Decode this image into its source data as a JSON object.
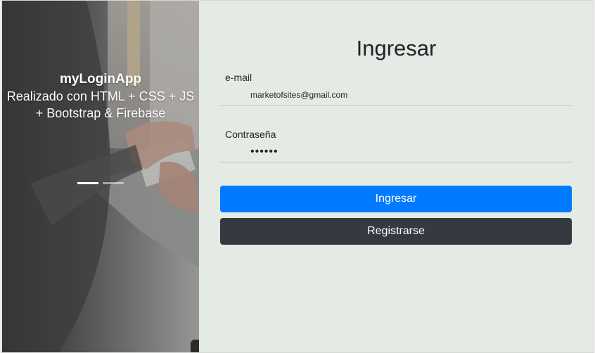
{
  "hero": {
    "title": "myLoginApp",
    "subtitle": "Realizado con HTML + CSS + JS + Bootstrap & Firebase",
    "slides": 2,
    "active_slide": 1
  },
  "form": {
    "title": "Ingresar",
    "email_label": "e-mail",
    "email_value": "marketofsites@gmail.com",
    "password_label": "Contraseña",
    "password_value": "••••••",
    "login_button": "Ingresar",
    "register_button": "Registrarse"
  },
  "colors": {
    "panel_background": "#e4eae4",
    "primary_button": "#007bff",
    "dark_button": "#343a40"
  }
}
